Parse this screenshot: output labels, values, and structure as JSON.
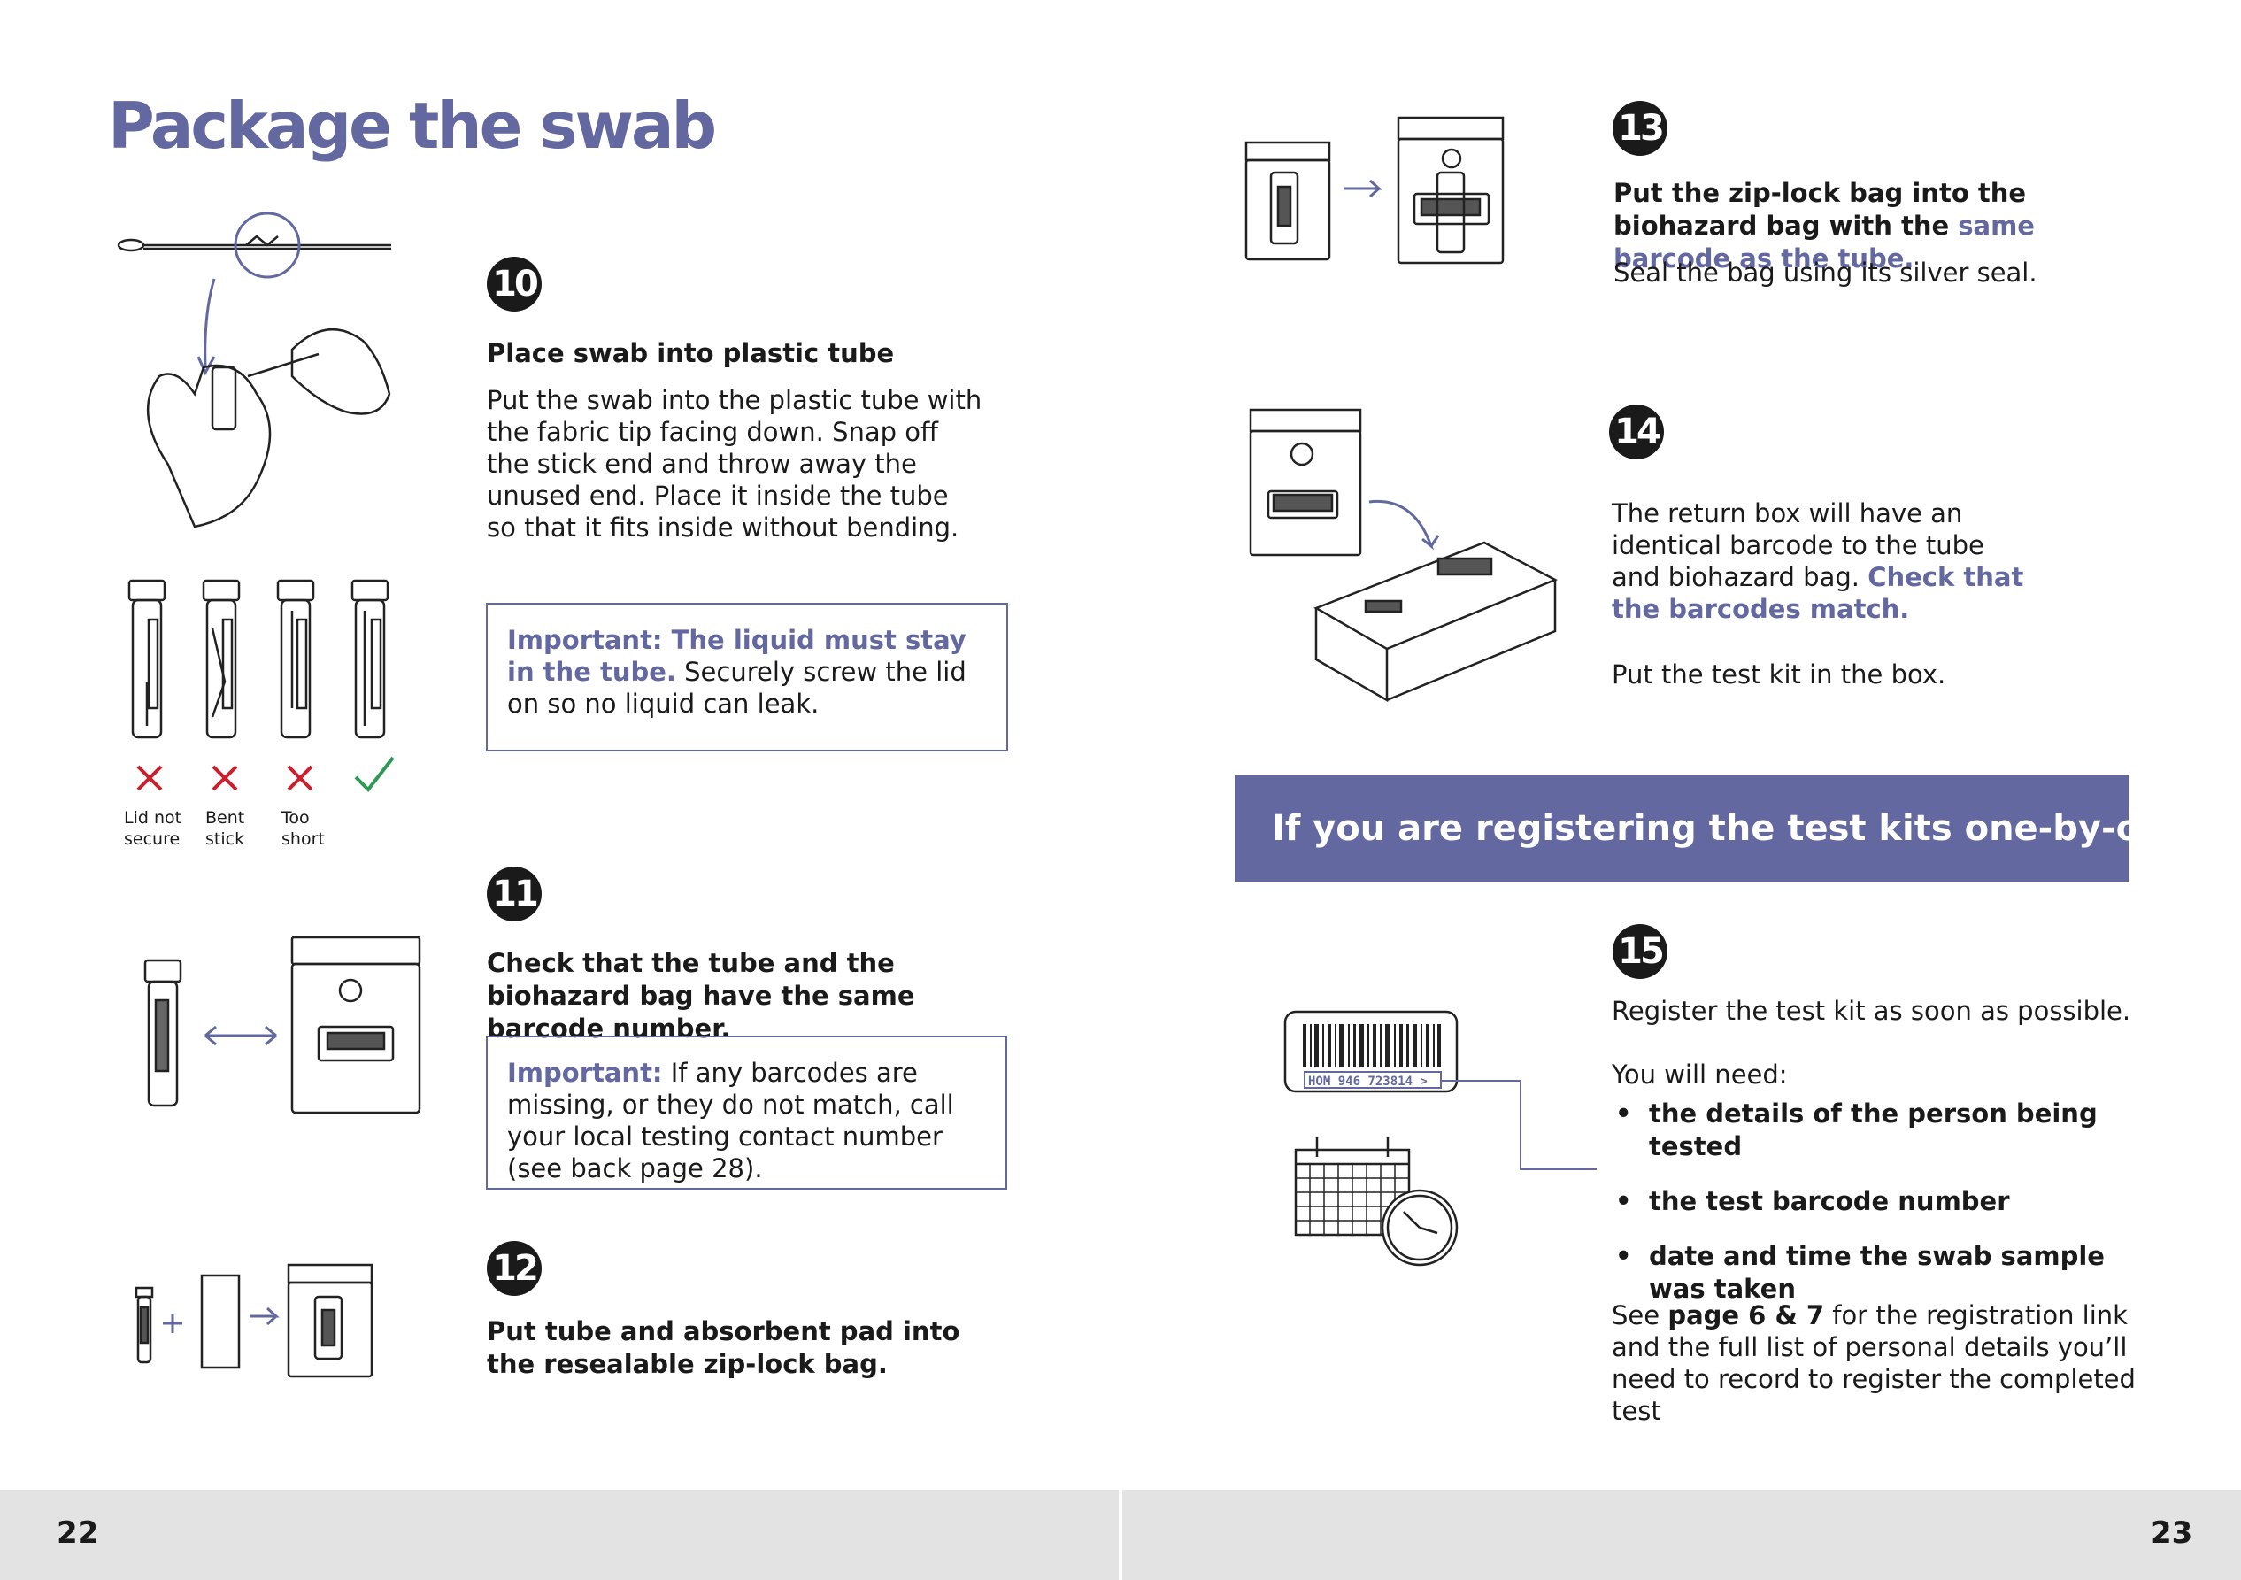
{
  "left_page": {
    "title": "Package the swab",
    "page_number": "22",
    "captions": [
      "Lid not\nsecure",
      "Bent\nstick",
      "Too\nshort"
    ],
    "step10": {
      "number": "10",
      "heading": "Place swab into plastic tube",
      "body": "Put the swab into the plastic tube with the fabric tip facing down. Snap off the stick end and throw away the unused end. Place it inside the tube so that it fits inside without bending.",
      "important_lead": "Important: The liquid must stay in the tube.",
      "important_rest": " Securely screw the lid on so no liquid can leak."
    },
    "step11": {
      "number": "11",
      "heading": "Check that the tube and the biohazard bag have the same barcode number.",
      "important_lead": "Important:",
      "important_rest": " If any barcodes are missing, or they do not match, call your local testing contact number (see back page 28)."
    },
    "step12": {
      "number": "12",
      "heading": "Put tube and absorbent pad into the resealable zip-lock bag."
    }
  },
  "right_page": {
    "page_number": "23",
    "step13": {
      "number": "13",
      "heading_lead": "Put the zip-lock bag into the biohazard bag with the ",
      "heading_accent": "same barcode as the tube.",
      "body": "Seal the bag using its silver seal."
    },
    "step14": {
      "number": "14",
      "body_lead": "The return box will have an identical barcode to the tube and biohazard bag. ",
      "body_accent": "Check that the barcodes match.",
      "body2": "Put the test kit in the box."
    },
    "banner": "If you are registering the test kits one-by-one",
    "step15": {
      "number": "15",
      "intro": "Register the test kit as soon as possible.",
      "you_need": "You will need:",
      "bullets": [
        "the details of the person being tested",
        "the test barcode number",
        "date and time the swab sample was taken"
      ],
      "see_lead": "See ",
      "see_bold": "page 6 & 7",
      "see_rest": " for the registration link and the full list of personal details you’ll need to record to register the completed test"
    },
    "barcode_text": "HOM 946 723814 >"
  },
  "colors": {
    "accent": "#6369a0",
    "wrong": "#c8202f",
    "right": "#2e9a55",
    "footer": "#e3e3e3"
  }
}
